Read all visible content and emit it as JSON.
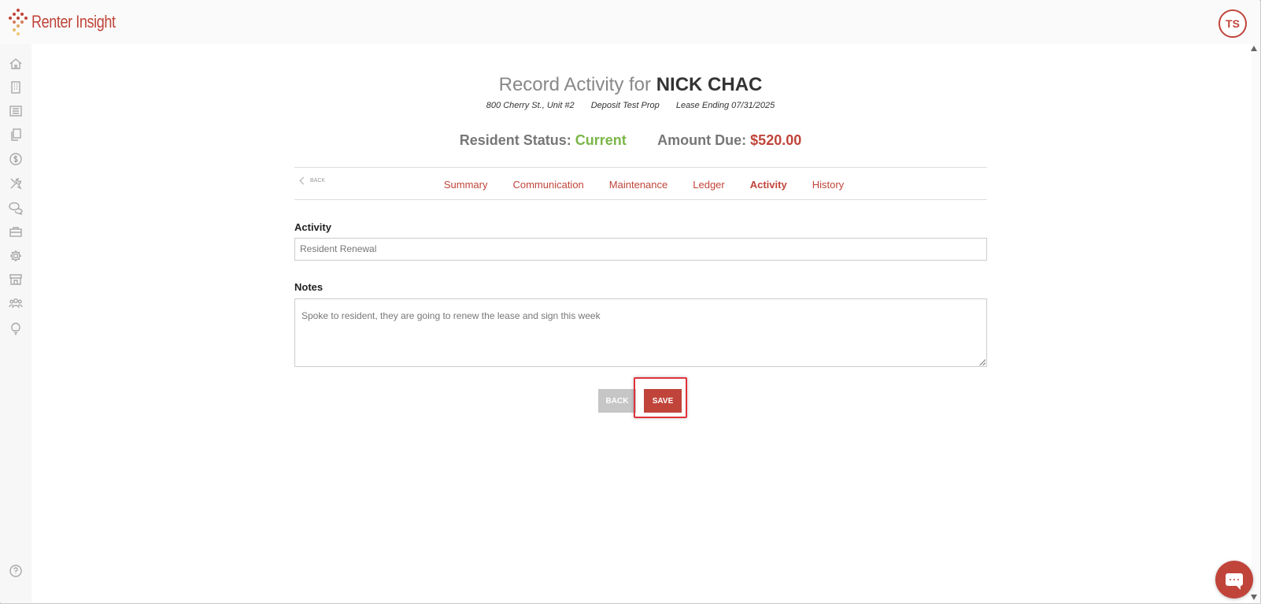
{
  "app": {
    "brand": "Renter Insight",
    "user_initials": "TS",
    "brand_color": "#c0443a"
  },
  "sidebar": {
    "items": [
      {
        "icon": "home-icon"
      },
      {
        "icon": "building-icon"
      },
      {
        "icon": "list-icon"
      },
      {
        "icon": "documents-icon"
      },
      {
        "icon": "dollar-icon"
      },
      {
        "icon": "tools-icon"
      },
      {
        "icon": "chat-icon"
      },
      {
        "icon": "briefcase-icon"
      },
      {
        "icon": "gear-icon"
      },
      {
        "icon": "storefront-icon"
      },
      {
        "icon": "people-icon"
      },
      {
        "icon": "lightbulb-icon"
      },
      {
        "icon": "help-icon"
      }
    ]
  },
  "page": {
    "title_prefix": "Record Activity for",
    "resident_name": "NICK CHAC",
    "address": "800 Cherry St., Unit #2",
    "property": "Deposit Test Prop",
    "lease": "Lease Ending 07/31/2025",
    "status_label": "Resident Status:",
    "status_value": "Current",
    "status_color": "#7ab648",
    "amount_label": "Amount Due:",
    "amount_value": "$520.00",
    "amount_color": "#c0443a"
  },
  "nav": {
    "back_label": "BACK",
    "tabs": [
      {
        "label": "Summary"
      },
      {
        "label": "Communication"
      },
      {
        "label": "Maintenance"
      },
      {
        "label": "Ledger"
      },
      {
        "label": "Activity",
        "active": true
      },
      {
        "label": "History"
      }
    ]
  },
  "form": {
    "activity_label": "Activity",
    "activity_value": "Resident Renewal",
    "notes_label": "Notes",
    "notes_value": "Spoke to resident, they are going to renew the lease and sign this week",
    "back_button": "BACK",
    "save_button": "SAVE"
  }
}
